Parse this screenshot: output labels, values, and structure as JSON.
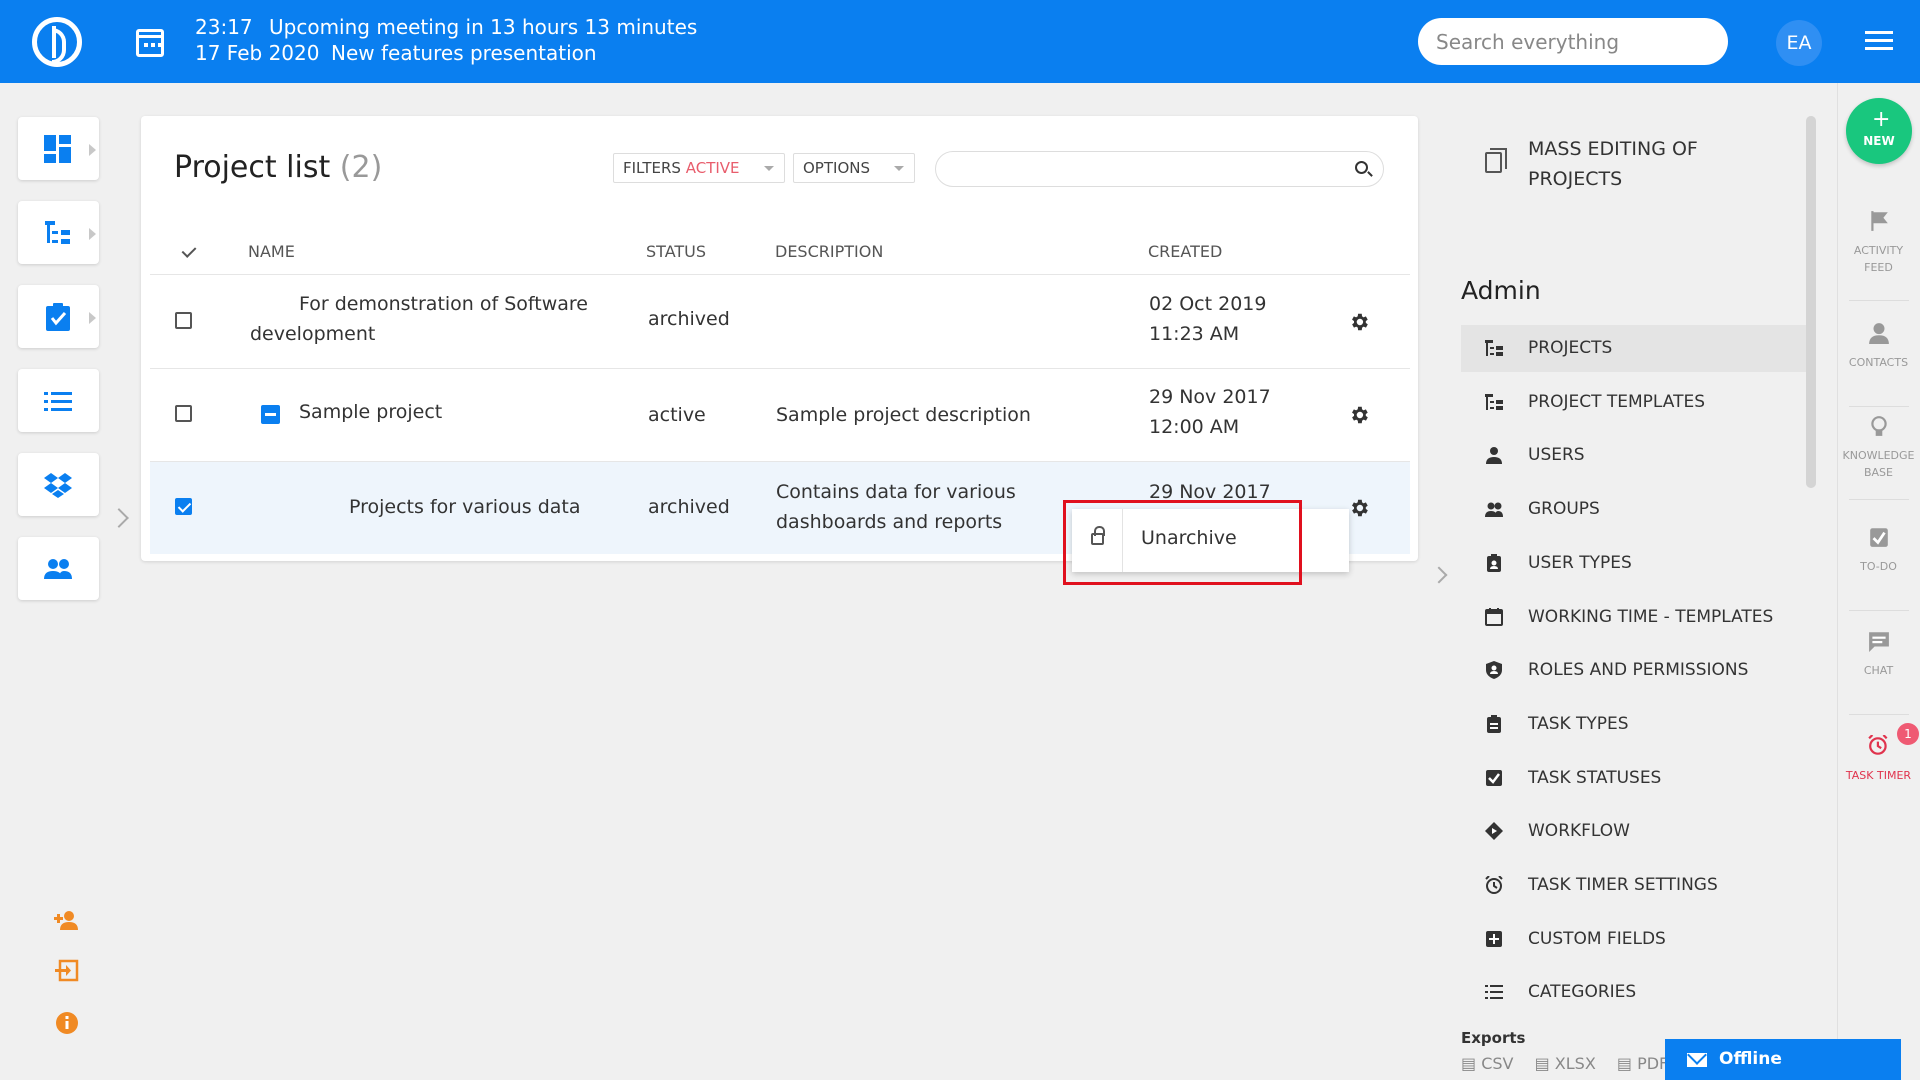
{
  "header": {
    "time": "23:17",
    "meeting": "Upcoming meeting in 13 hours 13 minutes",
    "date": "17 Feb 2020",
    "event": "New features presentation",
    "search_placeholder": "Search everything",
    "avatar_initials": "EA"
  },
  "project_list": {
    "title": "Project list",
    "count": "(2)",
    "filters_label": "FILTERS",
    "filters_state": "ACTIVE",
    "options_label": "OPTIONS",
    "columns": [
      "NAME",
      "STATUS",
      "DESCRIPTION",
      "CREATED"
    ],
    "rows": [
      {
        "name_line1": "For demonstration of Software",
        "name_line2": "development",
        "status": "archived",
        "description_line1": "",
        "description_line2": "",
        "created_date": "02 Oct 2019",
        "created_time": "11:23 AM",
        "checked": false
      },
      {
        "name_line1": "Sample project",
        "name_line2": "",
        "status": "active",
        "description_line1": "Sample project description",
        "description_line2": "",
        "created_date": "29 Nov 2017",
        "created_time": "12:00 AM",
        "checked": false
      },
      {
        "name_line1": "Projects for various data",
        "name_line2": "",
        "status": "archived",
        "description_line1": "Contains data for various",
        "description_line2": "dashboards and reports",
        "created_date": "29 Nov 2017",
        "created_time": "",
        "checked": true
      }
    ],
    "context_menu": {
      "item": "Unarchive",
      "icon": "lock-icon"
    }
  },
  "admin": {
    "mass_editing": "MASS EDITING OF PROJECTS",
    "heading": "Admin",
    "items": [
      {
        "label": "PROJECTS",
        "icon": "project-tree-icon",
        "selected": true
      },
      {
        "label": "PROJECT TEMPLATES",
        "icon": "project-tree-icon",
        "selected": false
      },
      {
        "label": "USERS",
        "icon": "user-icon",
        "selected": false
      },
      {
        "label": "GROUPS",
        "icon": "group-icon",
        "selected": false
      },
      {
        "label": "USER TYPES",
        "icon": "badge-icon",
        "selected": false
      },
      {
        "label": "WORKING TIME - TEMPLATES",
        "icon": "calendar-icon",
        "selected": false
      },
      {
        "label": "ROLES AND PERMISSIONS",
        "icon": "shield-icon",
        "selected": false
      },
      {
        "label": "TASK TYPES",
        "icon": "clipboard-icon",
        "selected": false
      },
      {
        "label": "TASK STATUSES",
        "icon": "checkbox-icon",
        "selected": false
      },
      {
        "label": "WORKFLOW",
        "icon": "diamond-icon",
        "selected": false
      },
      {
        "label": "TASK TIMER SETTINGS",
        "icon": "alarm-icon",
        "selected": false
      },
      {
        "label": "CUSTOM FIELDS",
        "icon": "plus-box-icon",
        "selected": false
      },
      {
        "label": "CATEGORIES",
        "icon": "list-icon",
        "selected": false
      }
    ],
    "exports_heading": "Exports",
    "exports": [
      "CSV",
      "XLSX",
      "PDF"
    ]
  },
  "rail": {
    "new_label": "NEW",
    "items": [
      {
        "label_line1": "ACTIVITY",
        "label_line2": "FEED",
        "icon": "flag-icon"
      },
      {
        "label_line1": "CONTACTS",
        "label_line2": "",
        "icon": "person-icon"
      },
      {
        "label_line1": "KNOWLEDGE",
        "label_line2": "BASE",
        "icon": "bulb-icon"
      },
      {
        "label_line1": "TO-DO",
        "label_line2": "",
        "icon": "todo-icon"
      },
      {
        "label_line1": "CHAT",
        "label_line2": "",
        "icon": "chat-icon"
      },
      {
        "label_line1": "TASK TIMER",
        "label_line2": "",
        "icon": "alarm-icon"
      }
    ],
    "timer_badge": "1"
  },
  "chat": {
    "status": "Offline"
  },
  "colors": {
    "header": "#0a7ff0",
    "accent": "#0a7ff0",
    "new_button": "#19c77e",
    "filter_active": "#e85d6c",
    "timer": "#e0334d",
    "highlight": "#e0101e"
  }
}
